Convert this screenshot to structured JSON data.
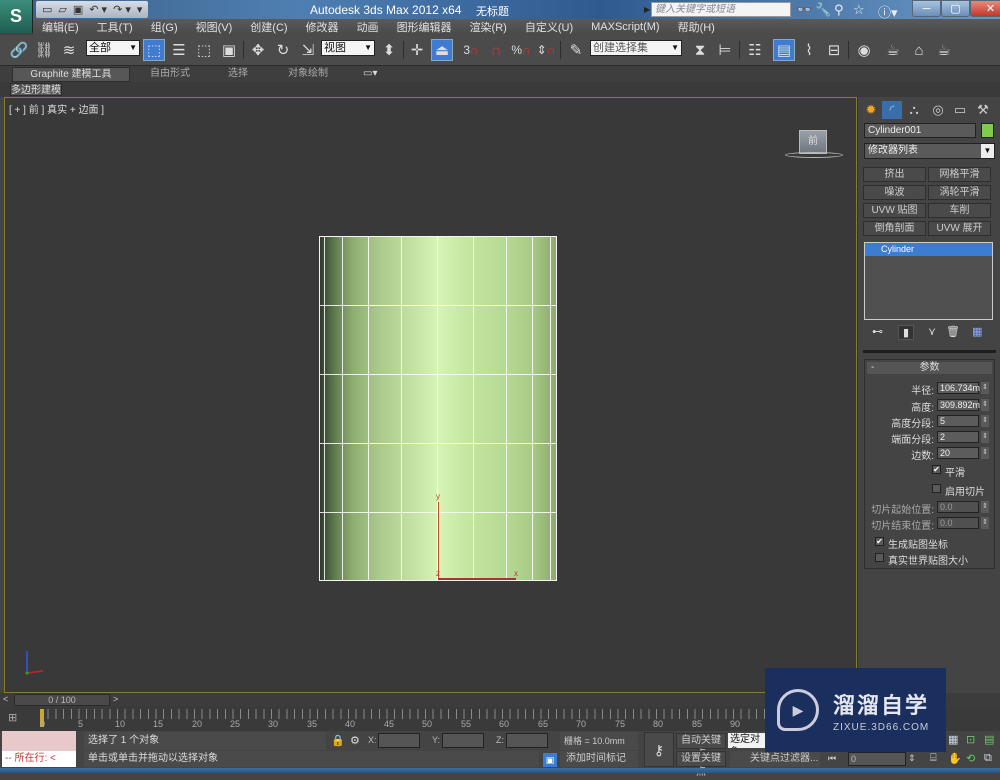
{
  "titlebar": {
    "app_title": "Autodesk 3ds Max  2012 x64",
    "document": "无标题",
    "search_placeholder": "键入关键字或短语",
    "quick_access": [
      "new",
      "open",
      "save",
      "undo",
      "redo"
    ],
    "icons": [
      "binoculars-icon",
      "wrench-icon",
      "satellite-icon",
      "star-icon",
      "help-icon"
    ]
  },
  "menu": [
    "编辑(E)",
    "工具(T)",
    "组(G)",
    "视图(V)",
    "创建(C)",
    "修改器",
    "动画",
    "图形编辑器",
    "渲染(R)",
    "自定义(U)",
    "MAXScript(M)",
    "帮助(H)"
  ],
  "toolbar": {
    "selection_filter": "全部",
    "ref_coord": "视图",
    "named_selection": "创建选择集",
    "snap_label": "3"
  },
  "ribbon": {
    "tabs": [
      "Graphite 建模工具",
      "自由形式",
      "选择",
      "对象绘制"
    ],
    "active_subtab": "多边形建模"
  },
  "viewport": {
    "label": "[ + ] 前 ] 真实 + 边面 ]",
    "viewcube_face": "前",
    "gizmo": {
      "y": "y",
      "x": "x",
      "z": "z"
    },
    "mesh": {
      "height_segments": 5,
      "visible_side_columns": 9
    }
  },
  "command_panel": {
    "object_name": "Cylinder001",
    "object_color": "#7ecb4e",
    "modifier_list": "修改器列表",
    "modifier_buttons": [
      "挤出",
      "网格平滑",
      "噪波",
      "涡轮平滑",
      "UVW 贴图",
      "车削",
      "倒角剖面",
      "UVW 展开"
    ],
    "stack": [
      "Cylinder"
    ],
    "rollout_title": "参数",
    "params": [
      {
        "label": "半径:",
        "value": "106.734m"
      },
      {
        "label": "高度:",
        "value": "309.892m"
      },
      {
        "label": "高度分段:",
        "value": "5"
      },
      {
        "label": "端面分段:",
        "value": "2"
      },
      {
        "label": "边数:",
        "value": "20"
      }
    ],
    "smooth": {
      "label": "平滑",
      "checked": true
    },
    "slice_on": {
      "label": "启用切片",
      "checked": false
    },
    "slice_from": {
      "label": "切片起始位置:",
      "value": "0.0"
    },
    "slice_to": {
      "label": "切片结束位置:",
      "value": "0.0"
    },
    "gen_mapping": {
      "label": "生成贴图坐标",
      "checked": true
    },
    "real_world": {
      "label": "真实世界贴图大小",
      "checked": false
    }
  },
  "timeline": {
    "frame_display": "0 / 100",
    "ticks": [
      "0",
      "5",
      "10",
      "15",
      "20",
      "25",
      "30",
      "35",
      "40",
      "45",
      "50",
      "55",
      "60",
      "65",
      "70",
      "75",
      "80",
      "85",
      "90"
    ]
  },
  "status": {
    "maxscript_label": "所在行:",
    "selection": "选择了 1 个对象",
    "hint": "单击或单击并拖动以选择对象",
    "x_label": "X:",
    "y_label": "Y:",
    "z_label": "Z:",
    "grid": "栅格 = 10.0mm",
    "add_time_tag": "添加时间标记",
    "auto_key": "自动关键点",
    "set_key": "设置关键点",
    "selected_object": "选定对象",
    "key_filters": "关键点过滤器...",
    "current_frame": "0"
  },
  "watermark": {
    "title": "溜溜自学",
    "url": "ZIXUE.3D66.COM"
  }
}
